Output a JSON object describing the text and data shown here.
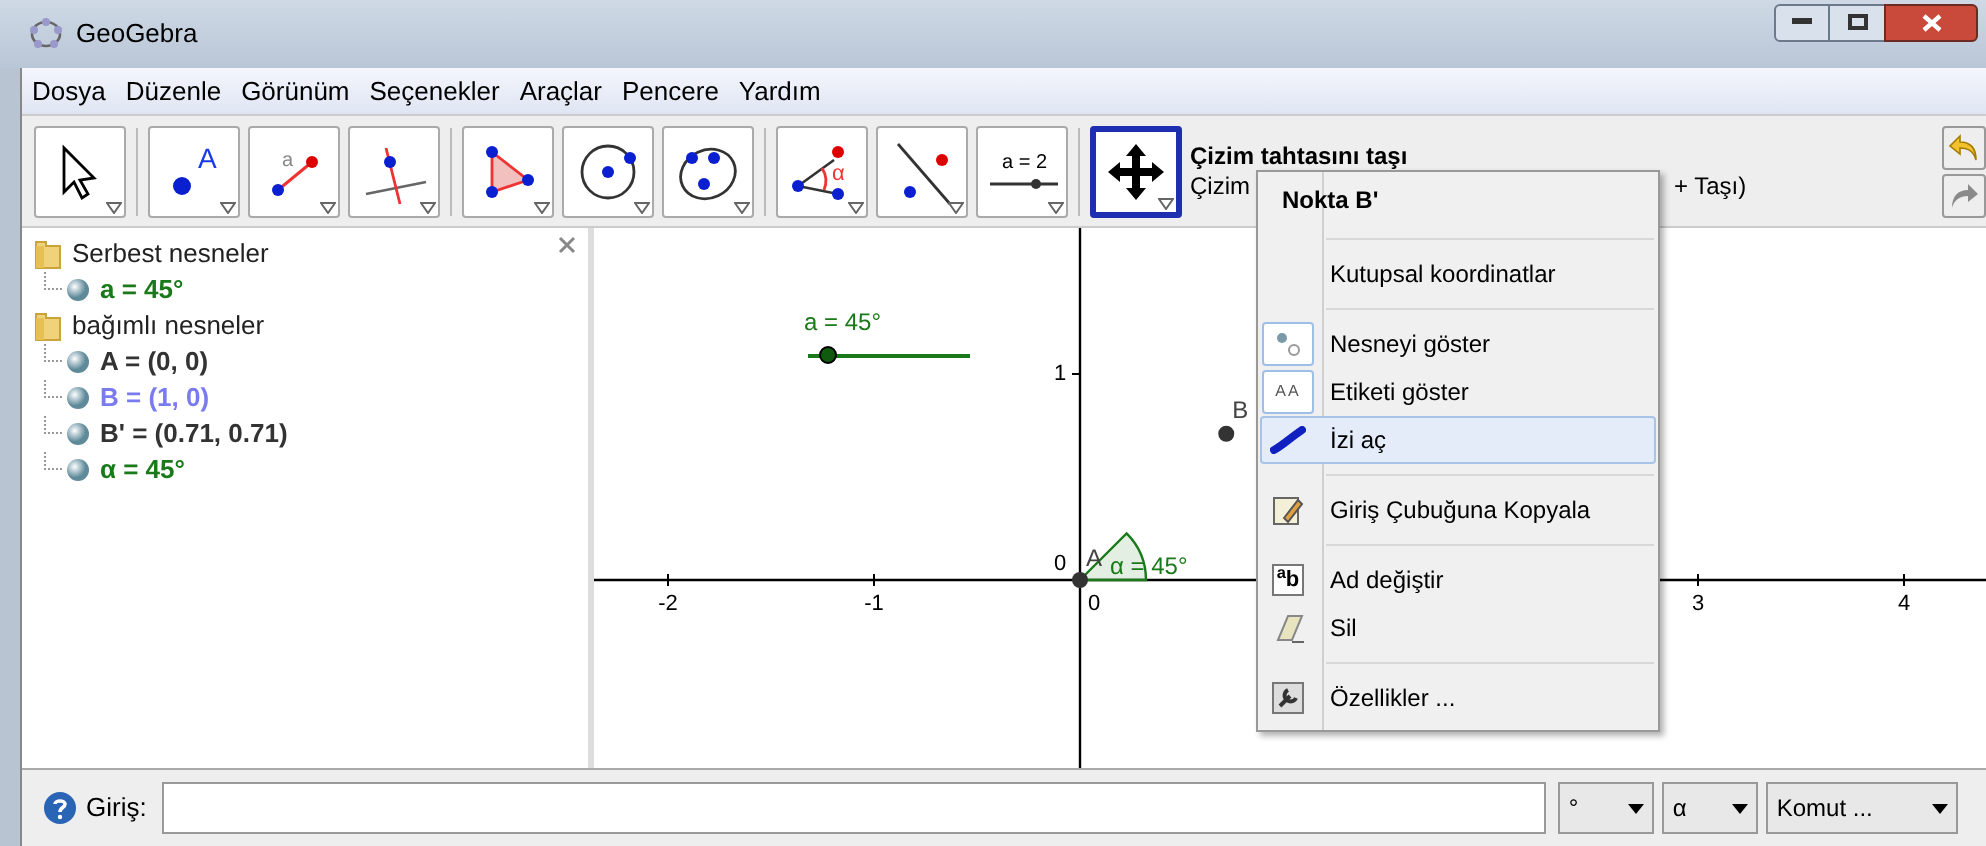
{
  "window": {
    "title": "GeoGebra"
  },
  "menu_bar": [
    "Dosya",
    "Düzenle",
    "Görünüm",
    "Seçenekler",
    "Araçlar",
    "Pencere",
    "Yardım"
  ],
  "toolbar": {
    "groups": [
      [
        {
          "selected": false
        }
      ],
      [
        {
          "glyph": "A",
          "selected": false
        },
        {
          "glyph": "a",
          "selected": false
        },
        {
          "selected": false
        }
      ],
      [
        {
          "selected": false
        },
        {
          "selected": false
        },
        {
          "selected": false
        }
      ],
      [
        {
          "glyph": "α",
          "selected": false
        },
        {
          "selected": false
        },
        {
          "glyph": "a = 2",
          "selected": false
        }
      ],
      [
        {
          "selected": true
        }
      ]
    ],
    "tool_title": "Çizim tahtasını taşı",
    "tool_help_start": "Çizim",
    "tool_help_end": "+ Taşı)"
  },
  "algebra": {
    "folders": [
      {
        "label": "Serbest nesneler",
        "children": [
          {
            "label": "a = 45°",
            "color": "#1a7a1a"
          }
        ]
      },
      {
        "label": "bağımlı nesneler",
        "children": [
          {
            "label": "A = (0, 0)",
            "color": "#333333"
          },
          {
            "label": "B = (1, 0)",
            "color": "#7b7bf0"
          },
          {
            "label": "B' = (0.71, 0.71)",
            "color": "#333333"
          },
          {
            "label": "α = 45°",
            "color": "#1a7a1a"
          }
        ]
      }
    ]
  },
  "graphics": {
    "x_labels": [
      "-2",
      "-1",
      "0",
      "3",
      "4"
    ],
    "y_labels": [
      "1",
      "0"
    ],
    "slider": {
      "label": "a = 45°",
      "level": 0.125
    },
    "point_labels": [
      "B",
      "A"
    ],
    "angle_label": "α = 45°"
  },
  "context_menu": {
    "title": "Nokta B'",
    "items": [
      {
        "kind": "separator"
      },
      {
        "kind": "action",
        "label": "Kutupsal koordinatlar",
        "selected": false
      },
      {
        "kind": "separator"
      },
      {
        "kind": "toggle",
        "label": "Nesneyi göster",
        "checked": true,
        "selected": false
      },
      {
        "kind": "toggle",
        "label": "Etiketi göster",
        "icon_text": "AA",
        "checked": true,
        "selected": false
      },
      {
        "kind": "toggle",
        "label": "İzi aç",
        "checked": false,
        "selected": true
      },
      {
        "kind": "separator"
      },
      {
        "kind": "action",
        "label": "Giriş Çubuğuna Kopyala",
        "selected": false
      },
      {
        "kind": "separator"
      },
      {
        "kind": "action",
        "label": "Ad değiştir",
        "icon_text": "$^{a}$b",
        "selected": false
      },
      {
        "kind": "action",
        "label": "Sil",
        "selected": false
      },
      {
        "kind": "separator"
      },
      {
        "kind": "action",
        "label": "Özellikler ...",
        "selected": false
      }
    ]
  },
  "input_bar": {
    "label": "Giriş:",
    "dropdowns": [
      "°",
      "α",
      "Komut ..."
    ]
  }
}
